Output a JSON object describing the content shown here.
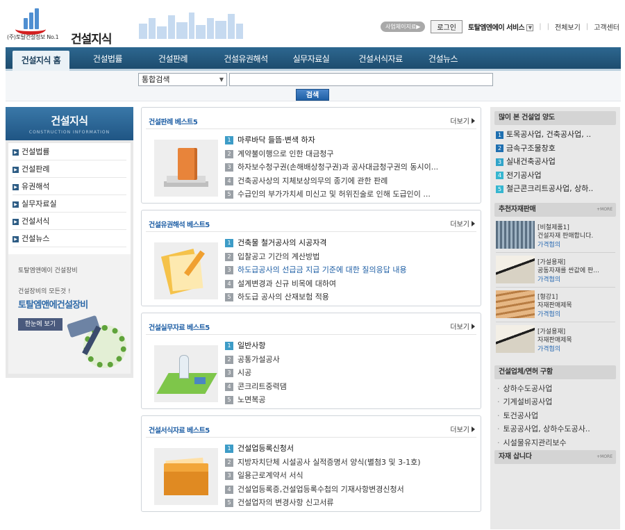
{
  "header": {
    "logo_tag": "(주)토탈건설정보 No.1",
    "logo_name": "건설지식",
    "util": {
      "pill": "사업체이지료▶",
      "login": "로그인",
      "service": "토탈엠엔에이 서비스",
      "service_dropdown": "▼",
      "sitemap": "전체보기",
      "support": "고객센터"
    }
  },
  "nav": {
    "items": [
      {
        "label": "건설지식 홈"
      },
      {
        "label": "건설법률"
      },
      {
        "label": "건설판례"
      },
      {
        "label": "건설유권해석"
      },
      {
        "label": "실무자료실"
      },
      {
        "label": "건설서식자료"
      },
      {
        "label": "건설뉴스"
      }
    ]
  },
  "search": {
    "select_value": "통합검색",
    "input_value": "",
    "button_label": "검색"
  },
  "left": {
    "title": "건설지식",
    "subtitle": "CONSTRUCTION INFORMATION",
    "menu": [
      {
        "label": "건설법률"
      },
      {
        "label": "건설판례"
      },
      {
        "label": "유권해석"
      },
      {
        "label": "실무자료실"
      },
      {
        "label": "건설서식"
      },
      {
        "label": "건설뉴스"
      }
    ],
    "equipment": {
      "line1": "토탈엠앤에이 건설장비",
      "line2": "건설장비의 모든것 !",
      "brand": "토탈엠앤에건설장비",
      "button": "한눈에 보기"
    }
  },
  "boxes": [
    {
      "title": "건설판례 베스트5",
      "more": "더보기",
      "thumb_icon": "book-icon",
      "items": [
        {
          "n": "1",
          "text": "마루바닥 들뜸·변색 하자"
        },
        {
          "n": "2",
          "text": "계약불이행으로 인한 대금청구"
        },
        {
          "n": "3",
          "text": "하자보수청구권(손해배상청구권)과 공사대금청구권의 동시이..."
        },
        {
          "n": "4",
          "text": "건축공사상의 지체보상의무의 종기에 관한 판례"
        },
        {
          "n": "5",
          "text": "수급인의 부가가치세 미신고 및 허위진술로 인해 도급인이 ..."
        }
      ]
    },
    {
      "title": "건설유권해석 베스트5",
      "more": "더보기",
      "thumb_icon": "paper-pencil-icon",
      "items": [
        {
          "n": "1",
          "text": "건축물 철거공사의 시공자격"
        },
        {
          "n": "2",
          "text": "입찰공고 기간의 계산방법"
        },
        {
          "n": "3",
          "text": "하도급공사의 선급금 지급 기준에 대한 질의응답 내용"
        },
        {
          "n": "4",
          "text": "설계변경과 신규 비목에 대하여"
        },
        {
          "n": "5",
          "text": "하도급 공사의 산재보험 적용"
        }
      ]
    },
    {
      "title": "건설실무자료 베스트5",
      "more": "더보기",
      "thumb_icon": "map-icon",
      "items": [
        {
          "n": "1",
          "text": "일반사항"
        },
        {
          "n": "2",
          "text": "공통가설공사"
        },
        {
          "n": "3",
          "text": "시공"
        },
        {
          "n": "4",
          "text": "콘크리트중력댐"
        },
        {
          "n": "5",
          "text": "노면복공"
        }
      ]
    },
    {
      "title": "건설서식자료 베스트5",
      "more": "더보기",
      "thumb_icon": "folder-icon",
      "items": [
        {
          "n": "1",
          "text": "건설업등록신청서"
        },
        {
          "n": "2",
          "text": "지방자치단체 시설공사 실적증명서 양식(별첨3 및 3-1호)"
        },
        {
          "n": "3",
          "text": "일용근로계약서 서식"
        },
        {
          "n": "4",
          "text": "건설업등록증,건설업등록수첩의 기재사항변경신청서"
        },
        {
          "n": "5",
          "text": "건설업자의 변경사항 신고서류"
        }
      ]
    }
  ],
  "right": {
    "popular_title": "많이 본 건설업 양도",
    "popular": [
      {
        "n": "1",
        "text": "토목공사업, 건축공사업, .."
      },
      {
        "n": "2",
        "text": "금속구조물창호"
      },
      {
        "n": "3",
        "text": "실내건축공사업"
      },
      {
        "n": "4",
        "text": "전기공사업"
      },
      {
        "n": "5",
        "text": "철근콘크리트공사업, 상하.."
      }
    ],
    "products_title": "추천자재판매",
    "products_more": "+MORE",
    "products": [
      {
        "tag": "[비철제품1]",
        "desc": "건설자재 판매합니다.",
        "price": "가격협의"
      },
      {
        "tag": "[가설용재]",
        "desc": "공동자재를 싼값에 판...",
        "price": "가격협의"
      },
      {
        "tag": "[형강1]",
        "desc": "자재판매제목",
        "price": "가격협의"
      },
      {
        "tag": "[가설용재]",
        "desc": "자재판매제목",
        "price": "가격협의"
      }
    ],
    "biz_title": "건설업체/면허 구함",
    "biz": [
      {
        "text": "상하수도공사업"
      },
      {
        "text": "기계설비공사업"
      },
      {
        "text": "토건공사업"
      },
      {
        "text": "토공공사업, 상하수도공사.."
      },
      {
        "text": "시설물유지관리보수"
      }
    ],
    "buy_title": "자재 삽니다",
    "buy_more": "+MORE"
  }
}
